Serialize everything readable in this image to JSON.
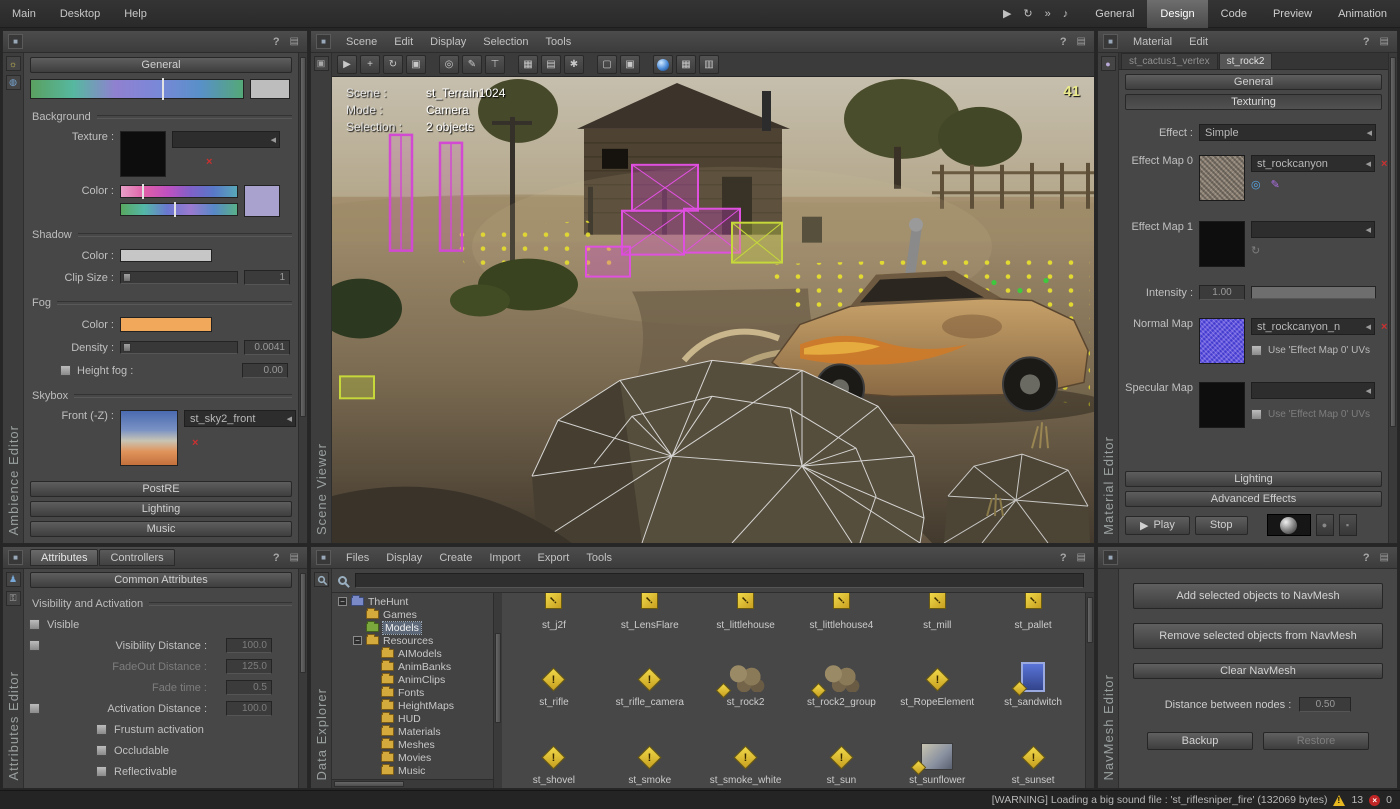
{
  "topbar": {
    "menus": [
      "Main",
      "Desktop",
      "Help"
    ],
    "tabs": [
      "General",
      "Design",
      "Code",
      "Preview",
      "Animation"
    ],
    "active_tab": "Design"
  },
  "icons": {
    "help": "?",
    "panel_menu": "▤",
    "corner": "■",
    "play": "▶",
    "loop": "↻",
    "step": "»",
    "audio": "♪",
    "cursor": "▶",
    "move": "+",
    "rotate": "↻",
    "scale": "▣",
    "pick": "◎",
    "paint": "✎",
    "measure": "⊤",
    "graph": "▦",
    "hierarchy": "▤",
    "settings": "✱",
    "box": "▢",
    "boxes": "▣",
    "grid": "▦",
    "stats": "▥",
    "minus": "−",
    "close": "×",
    "refresh": "↻",
    "uv_edit": "◎",
    "paint_edit": "✎",
    "bulb": "●",
    "wheel": "▪"
  },
  "ambience": {
    "title": "Ambience Editor",
    "general_button": "General",
    "background_header": "Background",
    "texture_label": "Texture :",
    "color_label": "Color :",
    "shadow_header": "Shadow",
    "shadow_color_label": "Color :",
    "clip_size_label": "Clip Size :",
    "clip_size_value": "1",
    "fog_header": "Fog",
    "fog_color_label": "Color :",
    "density_label": "Density :",
    "density_value": "0.0041",
    "height_fog_label": "Height fog :",
    "height_fog_value": "0.00",
    "skybox_header": "Skybox",
    "front_label": "Front (-Z) :",
    "front_value": "st_sky2_front",
    "bottom_buttons": [
      "PostRE",
      "Lighting",
      "Music"
    ],
    "colors": {
      "fog_swatch": "#f2a85a",
      "shadow_swatch": "#c6c6c6",
      "bg_color_swatch": "#a9a2cf"
    }
  },
  "scene": {
    "title": "Scene Viewer",
    "menus": [
      "Scene",
      "Edit",
      "Display",
      "Selection",
      "Tools"
    ],
    "overlay": {
      "scene_label": "Scene :",
      "scene_value": "st_Terrain1024",
      "mode_label": "Mode :",
      "mode_value": "Camera",
      "selection_label": "Selection :",
      "selection_value": "2 objects",
      "fps": "41"
    }
  },
  "material": {
    "title": "Material Editor",
    "menus": [
      "Material",
      "Edit"
    ],
    "tabs": [
      "st_cactus1_vertex",
      "st_rock2"
    ],
    "active_tab": "st_rock2",
    "general_button": "General",
    "texturing_button": "Texturing",
    "effect_label": "Effect :",
    "effect_value": "Simple",
    "map0_label": "Effect Map 0",
    "map0_value": "st_rockcanyon",
    "map1_label": "Effect Map 1",
    "intensity_label": "Intensity :",
    "intensity_value": "1.00",
    "normal_label": "Normal Map",
    "normal_value": "st_rockcanyon_n",
    "normal_uv_label": "Use 'Effect Map 0' UVs",
    "specular_label": "Specular Map",
    "specular_uv_label": "Use 'Effect Map 0' UVs",
    "lighting_button": "Lighting",
    "advanced_button": "Advanced Effects",
    "play_button": "Play",
    "stop_button": "Stop"
  },
  "attributes": {
    "title": "Attributes Editor",
    "tabs": [
      "Attributes",
      "Controllers"
    ],
    "active_tab": "Attributes",
    "header_button": "Common Attributes",
    "section": "Visibility and Activation",
    "rows": [
      {
        "label": "Visible",
        "checkbox": true
      },
      {
        "label": "Visibility Distance :",
        "checkbox": true,
        "value": "100.0"
      },
      {
        "label": "FadeOut Distance :",
        "value": "125.0",
        "disabled": true
      },
      {
        "label": "Fade time :",
        "value": "0.5",
        "disabled": true
      },
      {
        "label": "Activation Distance :",
        "checkbox": true,
        "value": "100.0"
      },
      {
        "label": "Frustum activation",
        "checkbox": true,
        "indent": true
      },
      {
        "label": "Occludable",
        "checkbox": true,
        "indent": true
      },
      {
        "label": "Reflectivable",
        "checkbox": true,
        "indent": true
      }
    ]
  },
  "data_explorer": {
    "title": "Data Explorer",
    "menus": [
      "Files",
      "Display",
      "Create",
      "Import",
      "Export",
      "Tools"
    ],
    "search_value": "",
    "tree": [
      {
        "label": "TheHunt",
        "depth": 0,
        "expander": true,
        "folder": "blue"
      },
      {
        "label": "Games",
        "depth": 1,
        "folder": "yellow"
      },
      {
        "label": "Models",
        "depth": 1,
        "folder": "green",
        "selected": true
      },
      {
        "label": "Resources",
        "depth": 1,
        "expander": true,
        "folder": "yellow"
      },
      {
        "label": "AIModels",
        "depth": 2,
        "folder": "yellow"
      },
      {
        "label": "AnimBanks",
        "depth": 2,
        "folder": "yellow"
      },
      {
        "label": "AnimClips",
        "depth": 2,
        "folder": "yellow"
      },
      {
        "label": "Fonts",
        "depth": 2,
        "folder": "yellow"
      },
      {
        "label": "HeightMaps",
        "depth": 2,
        "folder": "yellow"
      },
      {
        "label": "HUD",
        "depth": 2,
        "folder": "yellow"
      },
      {
        "label": "Materials",
        "depth": 2,
        "folder": "yellow"
      },
      {
        "label": "Meshes",
        "depth": 2,
        "folder": "yellow"
      },
      {
        "label": "Movies",
        "depth": 2,
        "folder": "yellow"
      },
      {
        "label": "Music",
        "depth": 2,
        "folder": "yellow"
      }
    ],
    "items": [
      {
        "label": "st_j2f",
        "icon": "warning-diamond"
      },
      {
        "label": "st_LensFlare",
        "icon": "warning-diamond"
      },
      {
        "label": "st_littlehouse",
        "icon": "warning-diamond"
      },
      {
        "label": "st_littlehouse4",
        "icon": "warning-diamond"
      },
      {
        "label": "st_mill",
        "icon": "warning-diamond"
      },
      {
        "label": "st_pallet",
        "icon": "warning-diamond"
      },
      {
        "label": "st_rifle",
        "icon": "warning-diamond"
      },
      {
        "label": "st_rifle_camera",
        "icon": "warning-diamond"
      },
      {
        "label": "st_rock2",
        "icon": "rock-thumbnail"
      },
      {
        "label": "st_rock2_group",
        "icon": "rock-thumbnail"
      },
      {
        "label": "st_RopeElement",
        "icon": "warning-diamond"
      },
      {
        "label": "st_sandwitch",
        "icon": "sign-thumbnail"
      },
      {
        "label": "st_shovel",
        "icon": "warning-diamond"
      },
      {
        "label": "st_smoke",
        "icon": "warning-diamond"
      },
      {
        "label": "st_smoke_white",
        "icon": "warning-diamond"
      },
      {
        "label": "st_sun",
        "icon": "warning-diamond"
      },
      {
        "label": "st_sunflower",
        "icon": "box-thumbnail"
      },
      {
        "label": "st_sunset",
        "icon": "warning-diamond"
      }
    ]
  },
  "navmesh": {
    "title": "NavMesh Editor",
    "add_button": "Add selected objects to NavMesh",
    "remove_button": "Remove selected objects from NavMesh",
    "clear_button": "Clear NavMesh",
    "distance_label": "Distance between nodes :",
    "distance_value": "0.50",
    "backup_button": "Backup",
    "restore_button": "Restore"
  },
  "status_bar": {
    "message": "[WARNING] Loading a big sound file : 'st_riflesniper_fire' (132069 bytes)",
    "warning_count": "13",
    "error_count": "0"
  }
}
